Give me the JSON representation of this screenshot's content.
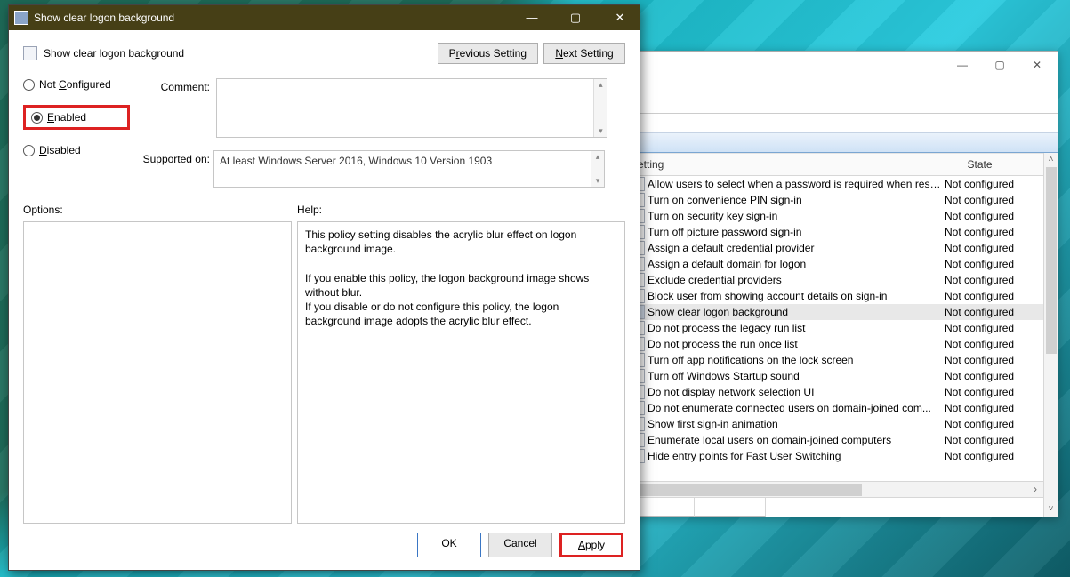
{
  "dialog": {
    "title": "Show clear logon background",
    "policy_name": "Show clear logon background",
    "prev_btn_pre": "P",
    "prev_btn_u": "r",
    "prev_btn_post": "evious Setting",
    "next_btn_u": "N",
    "next_btn_post": "ext Setting",
    "comment_label": "Comment:",
    "comment_value": "",
    "supported_label": "Supported on:",
    "supported_value": "At least Windows Server 2016, Windows 10 Version 1903",
    "options_label": "Options:",
    "help_label": "Help:",
    "radios": {
      "not_configured_u": "C",
      "not_configured_pre": "Not ",
      "not_configured_post": "onfigured",
      "enabled_u": "E",
      "enabled_post": "nabled",
      "disabled_u": "D",
      "disabled_post": "isabled",
      "selected": "enabled"
    },
    "help_text": "This policy setting disables the acrylic blur effect on logon background image.\n\n       If you enable this policy, the logon background image shows without blur.\n       If you disable or do not configure this policy, the logon background image adopts the acrylic blur effect.",
    "ok": "OK",
    "cancel": "Cancel",
    "apply_u": "A",
    "apply_post": "pply"
  },
  "gp": {
    "columns": {
      "setting": "Setting",
      "state": "State"
    },
    "state_default": "Not configured",
    "selected_index": 8,
    "items": [
      "Allow users to select when a password is required when resu...",
      "Turn on convenience PIN sign-in",
      "Turn on security key sign-in",
      "Turn off picture password sign-in",
      "Assign a default credential provider",
      "Assign a default domain for logon",
      "Exclude credential providers",
      "Block user from showing account details on sign-in",
      "Show clear logon background",
      "Do not process the legacy run list",
      "Do not process the run once list",
      "Turn off app notifications on the lock screen",
      "Turn off Windows Startup sound",
      "Do not display network selection UI",
      "Do not enumerate connected users on domain-joined com...",
      "Show first sign-in animation",
      "Enumerate local users on domain-joined computers",
      "Hide entry points for Fast User Switching"
    ]
  }
}
